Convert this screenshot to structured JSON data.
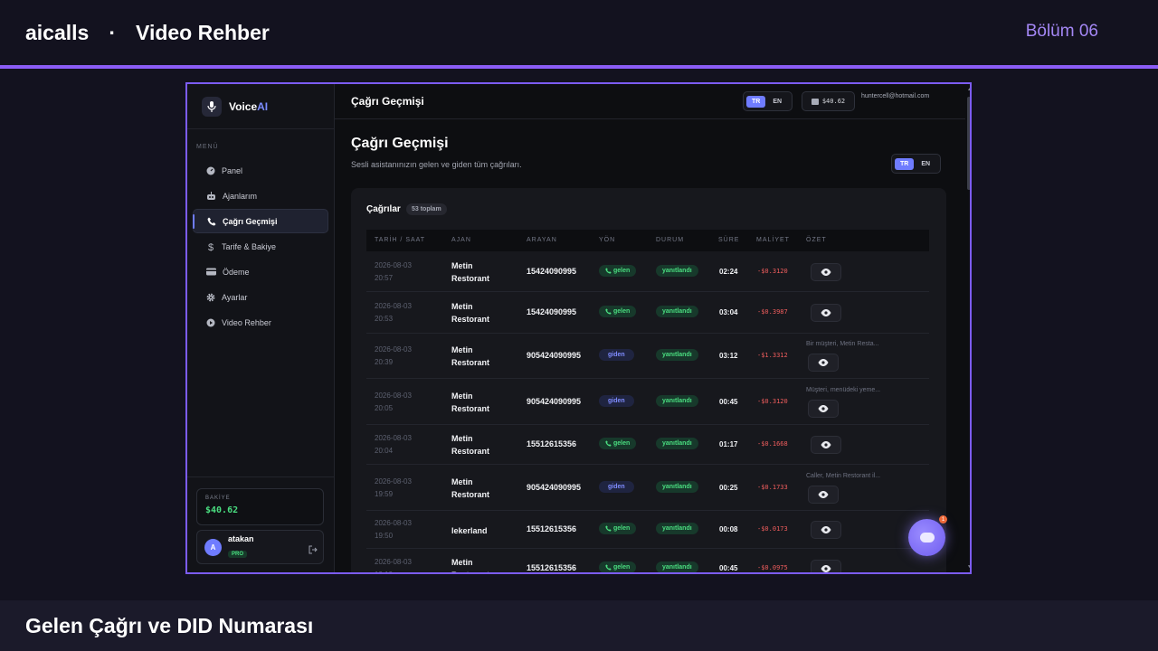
{
  "slide": {
    "brand": "aicalls",
    "separator": "·",
    "section": "Video Rehber",
    "chapter": "Bölüm 06",
    "caption": "Gelen Çağrı ve DID Numarası"
  },
  "app": {
    "logo_name": "Voice",
    "logo_accent": "AI",
    "menu_title": "MENÜ",
    "nav": [
      {
        "label": "Panel",
        "icon": "dashboard-icon"
      },
      {
        "label": "Ajanlarım",
        "icon": "robot-icon"
      },
      {
        "label": "Çağrı Geçmişi",
        "icon": "phone-icon",
        "active": true
      },
      {
        "label": "Tarife & Bakiye",
        "icon": "dollar-icon"
      },
      {
        "label": "Ödeme",
        "icon": "credit-card-icon"
      },
      {
        "label": "Ayarlar",
        "icon": "gear-icon"
      },
      {
        "label": "Video Rehber",
        "icon": "play-icon"
      }
    ],
    "balance_label": "BAKİYE",
    "balance_amount": "$40.62",
    "user_initial": "A",
    "user_name": "atakan",
    "user_plan": "PRO"
  },
  "header": {
    "title": "Çağrı Geçmişi",
    "lang_tr": "TR",
    "lang_en": "EN",
    "wallet": "$40.62",
    "email": "huntercell@hotmail.com"
  },
  "page": {
    "title": "Çağrı Geçmişi",
    "subtitle": "Sesli asistanınızın gelen ve giden tüm çağrıları.",
    "lang_tr": "TR",
    "lang_en": "EN"
  },
  "calls": {
    "title": "Çağrılar",
    "count": "53 toplam",
    "columns": [
      "TARİH / SAAT",
      "AJAN",
      "ARAYAN",
      "YÖN",
      "DURUM",
      "SÜRE",
      "MALİYET",
      "ÖZET"
    ],
    "rows": [
      {
        "date": "2026-08-03",
        "time": "20:57",
        "agent1": "Metin",
        "agent2": "Restorant",
        "caller": "15424090995",
        "dir": "gelen",
        "status": "yanıtlandı",
        "dur": "02:24",
        "cost": "-$0.3120",
        "summary": ""
      },
      {
        "date": "2026-08-03",
        "time": "20:53",
        "agent1": "Metin",
        "agent2": "Restorant",
        "caller": "15424090995",
        "dir": "gelen",
        "status": "yanıtlandı",
        "dur": "03:04",
        "cost": "-$0.3987",
        "summary": ""
      },
      {
        "date": "2026-08-03",
        "time": "20:39",
        "agent1": "Metin",
        "agent2": "Restorant",
        "caller": "905424090995",
        "dir": "giden",
        "status": "yanıtlandı",
        "dur": "03:12",
        "cost": "-$1.3312",
        "summary": "Bir müşteri, Metin Resta..."
      },
      {
        "date": "2026-08-03",
        "time": "20:05",
        "agent1": "Metin",
        "agent2": "Restorant",
        "caller": "905424090995",
        "dir": "giden",
        "status": "yanıtlandı",
        "dur": "00:45",
        "cost": "-$0.3120",
        "summary": "Müşteri, menüdeki yeme..."
      },
      {
        "date": "2026-08-03",
        "time": "20:04",
        "agent1": "Metin",
        "agent2": "Restorant",
        "caller": "15512615356",
        "dir": "gelen",
        "status": "yanıtlandı",
        "dur": "01:17",
        "cost": "-$0.1668",
        "summary": ""
      },
      {
        "date": "2026-08-03",
        "time": "19:59",
        "agent1": "Metin",
        "agent2": "Restorant",
        "caller": "905424090995",
        "dir": "giden",
        "status": "yanıtlandı",
        "dur": "00:25",
        "cost": "-$0.1733",
        "summary": "Caller, Metin Restorant il..."
      },
      {
        "date": "2026-08-03",
        "time": "19:50",
        "agent1": "lekerland",
        "agent2": "",
        "caller": "15512615356",
        "dir": "gelen",
        "status": "yanıtlandı",
        "dur": "00:08",
        "cost": "-$0.0173",
        "summary": ""
      },
      {
        "date": "2026-08-03",
        "time": "19:19",
        "agent1": "Metin",
        "agent2": "Restorant",
        "caller": "15512615356",
        "dir": "gelen",
        "status": "yanıtlandı",
        "dur": "00:45",
        "cost": "-$0.0975",
        "summary": ""
      }
    ]
  },
  "fab": {
    "badge": "1"
  },
  "colors": {
    "accent": "#8b5cf6",
    "primary": "#6f7cff",
    "success": "#4ade80",
    "danger": "#f05d5d"
  }
}
